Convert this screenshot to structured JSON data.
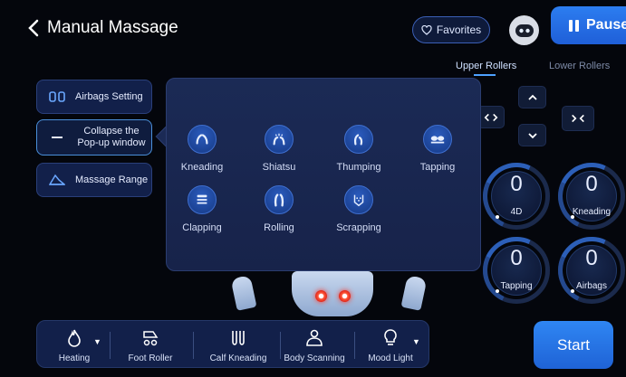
{
  "header": {
    "title": "Manual Massage",
    "favorites_label": "Favorites",
    "pause_label": "Pause"
  },
  "rollers": {
    "upper_label": "Upper Rollers",
    "lower_label": "Lower Rollers"
  },
  "directions": {
    "up": "^",
    "down": "v",
    "widen": "< >",
    "narrow": "><"
  },
  "dials": [
    {
      "value": "0",
      "label": "4D"
    },
    {
      "value": "0",
      "label": "Kneading"
    },
    {
      "value": "0",
      "label": "Tapping"
    },
    {
      "value": "0",
      "label": "Airbags"
    }
  ],
  "left_menu": {
    "airbags": "Airbags Setting",
    "collapse": "Collapse the Pop-up window",
    "range": "Massage Range"
  },
  "techniques": [
    {
      "label": "Kneading",
      "icon": "kneading-icon"
    },
    {
      "label": "Shiatsu",
      "icon": "shiatsu-icon"
    },
    {
      "label": "Thumping",
      "icon": "thumping-icon"
    },
    {
      "label": "Tapping",
      "icon": "tapping-icon"
    },
    {
      "label": "Clapping",
      "icon": "clapping-icon"
    },
    {
      "label": "Rolling",
      "icon": "rolling-icon"
    },
    {
      "label": "Scrapping",
      "icon": "scrapping-icon"
    }
  ],
  "bottom": {
    "heating": "Heating",
    "foot_roller": "Foot Roller",
    "calf_kneading": "Calf Kneading",
    "body_scanning": "Body Scanning",
    "mood_light": "Mood Light"
  },
  "start_label": "Start",
  "colors": {
    "background": "#04060c",
    "accent": "#2c7df0",
    "panel": "#12204a",
    "heat": "#e0261a"
  }
}
